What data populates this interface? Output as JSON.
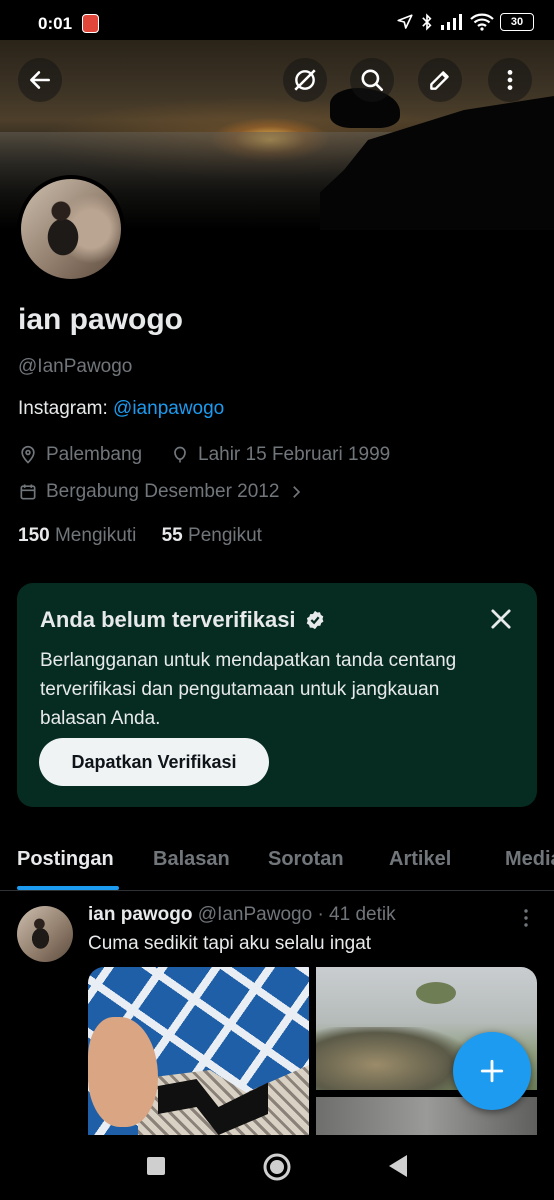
{
  "status_bar": {
    "time": "0:01",
    "battery": "30"
  },
  "profile": {
    "name": "ian pawogo",
    "handle": "@IanPawogo",
    "bio_prefix": "Instagram: ",
    "bio_link": "@ianpawogo",
    "location": "Palembang",
    "birthday": "Lahir 15 Februari 1999",
    "joined": "Bergabung Desember 2012",
    "following_count": "150",
    "following_label": "Mengikuti",
    "followers_count": "55",
    "followers_label": "Pengikut"
  },
  "verify_card": {
    "title": "Anda belum terverifikasi",
    "description": "Berlangganan untuk mendapatkan tanda centang terverifikasi dan pengutamaan untuk jangkauan balasan Anda.",
    "button": "Dapatkan Verifikasi"
  },
  "tabs": [
    "Postingan",
    "Balasan",
    "Sorotan",
    "Artikel",
    "Media"
  ],
  "post": {
    "name": "ian pawogo",
    "handle": "@IanPawogo",
    "time": "· 41 detik",
    "text": "Cuma sedikit tapi aku selalu ingat"
  },
  "colors": {
    "accent": "#1d9bf0",
    "card_bg": "#062c22",
    "background": "#000000"
  }
}
